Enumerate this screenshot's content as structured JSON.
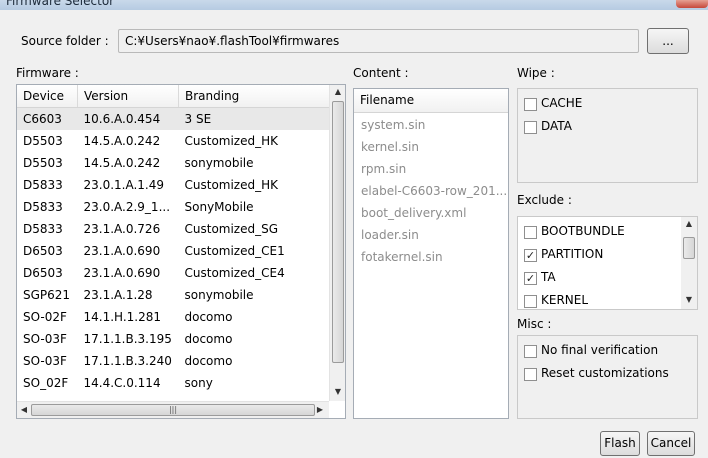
{
  "window": {
    "title": "Firmware Selector"
  },
  "source": {
    "label": "Source folder :",
    "value": "C:¥Users¥nao¥.flashTool¥firmwares",
    "browse_label": "..."
  },
  "firmware": {
    "label": "Firmware :",
    "columns": [
      "Device",
      "Version",
      "Branding"
    ],
    "rows": [
      {
        "device": "C6603",
        "version": "10.6.A.0.454",
        "branding": "3 SE"
      },
      {
        "device": "D5503",
        "version": "14.5.A.0.242",
        "branding": "Customized_HK"
      },
      {
        "device": "D5503",
        "version": "14.5.A.0.242",
        "branding": "sonymobile"
      },
      {
        "device": "D5833",
        "version": "23.0.1.A.1.49",
        "branding": "Customized_HK"
      },
      {
        "device": "D5833",
        "version": "23.0.A.2.9_1...",
        "branding": "SonyMobile"
      },
      {
        "device": "D5833",
        "version": "23.1.A.0.726",
        "branding": "Customized_SG"
      },
      {
        "device": "D6503",
        "version": "23.1.A.0.690",
        "branding": "Customized_CE1"
      },
      {
        "device": "D6503",
        "version": "23.1.A.0.690",
        "branding": "Customized_CE4"
      },
      {
        "device": "SGP621",
        "version": "23.1.A.1.28",
        "branding": "sonymobile"
      },
      {
        "device": "SO-02F",
        "version": "14.1.H.1.281",
        "branding": "docomo"
      },
      {
        "device": "SO-03F",
        "version": "17.1.1.B.3.195",
        "branding": "docomo"
      },
      {
        "device": "SO-03F",
        "version": "17.1.1.B.3.240",
        "branding": "docomo"
      },
      {
        "device": "SO_02F",
        "version": "14.4.C.0.114",
        "branding": "sony"
      }
    ],
    "selected_index": 0
  },
  "content": {
    "label": "Content :",
    "header": "Filename",
    "files": [
      "system.sin",
      "kernel.sin",
      "rpm.sin",
      "elabel-C6603-row_201...",
      "boot_delivery.xml",
      "loader.sin",
      "fotakernel.sin"
    ]
  },
  "wipe": {
    "label": "Wipe :",
    "items": [
      {
        "label": "CACHE",
        "checked": false
      },
      {
        "label": "DATA",
        "checked": false
      }
    ]
  },
  "exclude": {
    "label": "Exclude :",
    "items": [
      {
        "label": "BOOTBUNDLE",
        "checked": false
      },
      {
        "label": "PARTITION",
        "checked": true
      },
      {
        "label": "TA",
        "checked": true
      },
      {
        "label": "KERNEL",
        "checked": false
      }
    ]
  },
  "misc": {
    "label": "Misc :",
    "items": [
      {
        "label": "No final verification",
        "checked": false
      },
      {
        "label": "Reset customizations",
        "checked": false
      }
    ]
  },
  "buttons": {
    "flash": "Flash",
    "cancel": "Cancel"
  },
  "icons": {
    "check": "✓",
    "arrow_up": "▲",
    "arrow_down": "▼",
    "arrow_left": "◀",
    "arrow_right": "▶",
    "grip": "|||"
  }
}
